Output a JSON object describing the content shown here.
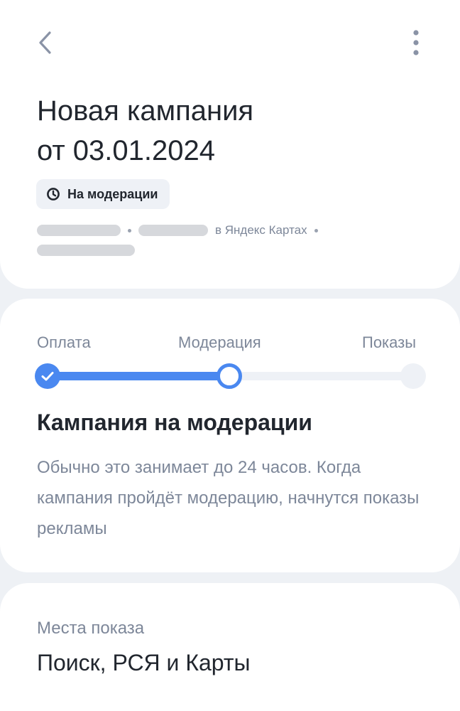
{
  "header": {
    "back_icon": "chevron-left-icon",
    "more_icon": "more-vertical-icon",
    "title_line1": "Новая кампания",
    "title_line2": "от 03.01.2024",
    "status": {
      "icon": "clock-icon",
      "label": "На модерации"
    },
    "meta_location": "в Яндекс Картах"
  },
  "progress": {
    "steps": [
      "Оплата",
      "Модерация",
      "Показы"
    ],
    "current_step": 2,
    "fraction_complete": 0.5,
    "accent_color": "#4a88f0",
    "title": "Кампания на модерации",
    "description": "Обычно это занимает до 24 часов. Когда кампания пройдёт модерацию, начнутся показы рекламы"
  },
  "places": {
    "label": "Места показа",
    "value": "Поиск, РСЯ и Карты"
  }
}
